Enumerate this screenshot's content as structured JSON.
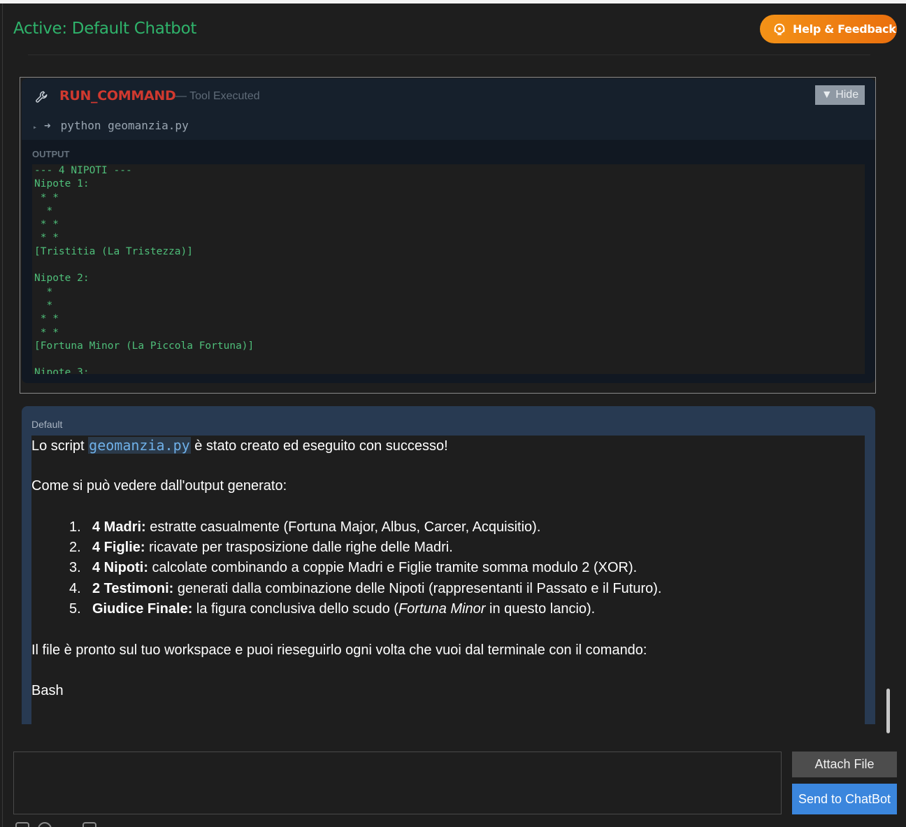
{
  "header": {
    "title": "Active: Default Chatbot",
    "help_label": "Help & Feedback"
  },
  "tool": {
    "name": "RUN_COMMAND",
    "status": "— Tool Executed",
    "hide_label": "▼ Hide",
    "command": "python geomanzia.py",
    "output_label": "OUTPUT",
    "output_text": "--- 4 NIPOTI ---\nNipote 1:\n * *\n  *\n * *\n * *\n[Tristitia (La Tristezza)]\n\nNipote 2:\n  *\n  *\n * *\n * *\n[Fortuna Minor (La Piccola Fortuna)]\n\nNipote 3:"
  },
  "message": {
    "author": "Default",
    "intro_before": "Lo script ",
    "intro_code": "geomanzia.py",
    "intro_after": " è stato creato ed eseguito con successo!",
    "lead": "Come si può vedere dall'output generato:",
    "items": [
      {
        "num": "1.",
        "bold": "4 Madri:",
        "text": " estratte casualmente (Fortuna Major, Albus, Carcer, Acquisitio)."
      },
      {
        "num": "2.",
        "bold": "4 Figlie:",
        "text": " ricavate per trasposizione dalle righe delle Madri."
      },
      {
        "num": "3.",
        "bold": "4 Nipoti:",
        "text": " calcolate combinando a coppie Madri e Figlie tramite somma modulo 2 (XOR)."
      },
      {
        "num": "4.",
        "bold": "2 Testimoni:",
        "text": " generati dalla combinazione delle Nipoti (rappresentanti il Passato e il Futuro)."
      },
      {
        "num": "5.",
        "bold": "Giudice Finale:",
        "text": " la figura conclusiva dello scudo (",
        "italic": "Fortuna Minor",
        "text2": " in questo lancio)."
      }
    ],
    "closing": "Il file è pronto sul tuo workspace e puoi rieseguirlo ogni volta che vuoi dal terminale con il comando:",
    "code_lang": "Bash"
  },
  "composer": {
    "attach_label": "Attach File",
    "send_label": "Send to ChatBot"
  },
  "colors": {
    "title": "#2fb36b",
    "tool_name": "#d0392f",
    "output_text": "#4fbf7a",
    "send_button": "#3b86dd",
    "help_button": "#f08314"
  }
}
